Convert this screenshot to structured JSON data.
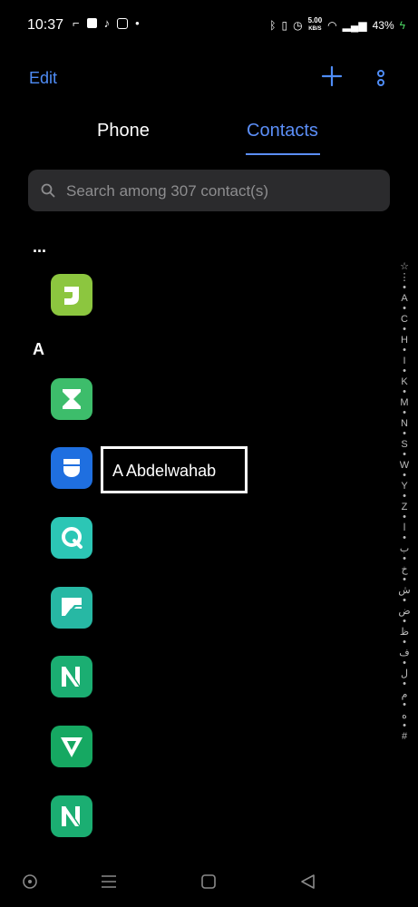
{
  "status_bar": {
    "time": "10:37",
    "speed_value": "5.00",
    "speed_unit": "KB/S",
    "battery": "43%"
  },
  "header": {
    "edit_label": "Edit",
    "add_icon": "plus-icon",
    "more_icon": "more-vertical-icon"
  },
  "tabs": [
    {
      "label": "Phone",
      "active": false
    },
    {
      "label": "Contacts",
      "active": true
    }
  ],
  "search": {
    "placeholder": "Search among 307 contact(s)"
  },
  "sections": [
    {
      "header": "..."
    },
    {
      "header": "A"
    }
  ],
  "contacts": [
    {
      "icon": "app-icon-lime",
      "color": "#8cc63f"
    },
    {
      "icon": "app-icon-hourglass",
      "color": "#3dbd6b"
    },
    {
      "icon": "app-icon-blue",
      "color": "#1f6fe0",
      "name": "A Abdelwahab"
    },
    {
      "icon": "app-icon-q",
      "color": "#2cc6b5"
    },
    {
      "icon": "app-icon-teal-flag",
      "color": "#27b8a4"
    },
    {
      "icon": "app-icon-green-m",
      "color": "#1bae72"
    },
    {
      "icon": "app-icon-green-w",
      "color": "#16a862"
    },
    {
      "icon": "app-icon-green-m2",
      "color": "#1bae72"
    }
  ],
  "alphabet_index": [
    "☆",
    "⋮",
    "•",
    "A",
    "•",
    "C",
    "•",
    "H",
    "•",
    "I",
    "•",
    "K",
    "•",
    "M",
    "•",
    "N",
    "•",
    "S",
    "•",
    "W",
    "•",
    "Y",
    "•",
    "Z",
    "•",
    "ا",
    "•",
    "ب",
    "•",
    "خ",
    "•",
    "ش",
    "•",
    "ض",
    "•",
    "ظ",
    "•",
    "ف",
    "•",
    "ل",
    "•",
    "م",
    "•",
    "ه",
    "•",
    "#"
  ],
  "accent_color": "#5b8ef7"
}
